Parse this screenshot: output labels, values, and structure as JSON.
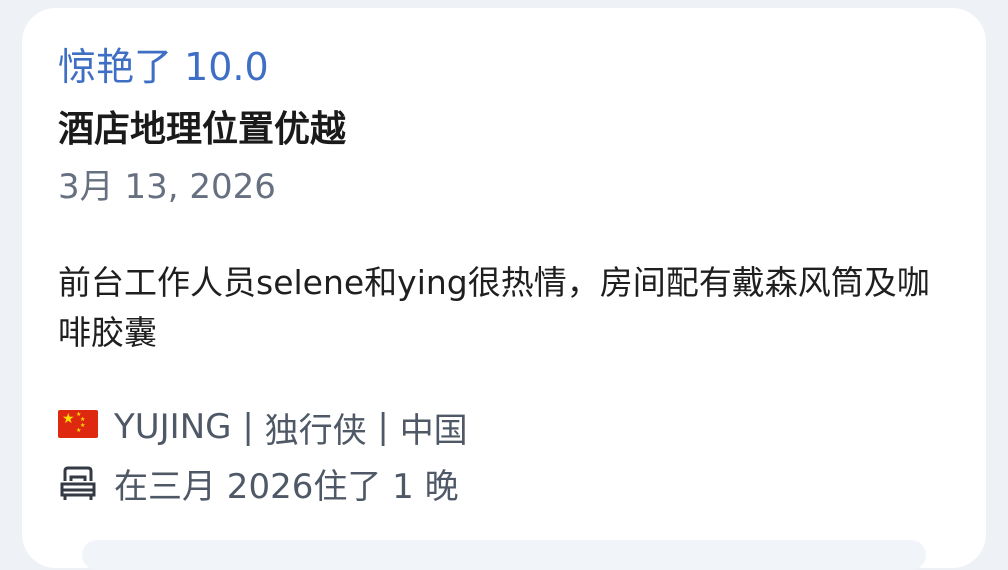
{
  "review": {
    "rating_label": "惊艳了 10.0",
    "title": "酒店地理位置优越",
    "date": "3月 13, 2026",
    "body": "前台工作人员selene和ying很热情，房间配有戴森风筒及咖啡胶囊",
    "reviewer": {
      "flag_icon": "china-flag-icon",
      "name": "YUJING",
      "separator": "|",
      "traveler_type": "独行侠",
      "country": "中国"
    },
    "stay": {
      "icon": "bed-icon",
      "text": "在三月 2026住了 1 晚"
    }
  },
  "colors": {
    "rating": "#3e6fc4",
    "title": "#1a1a1a",
    "meta": "#667080",
    "card_background": "#ffffff",
    "page_background": "#eef1f6"
  }
}
